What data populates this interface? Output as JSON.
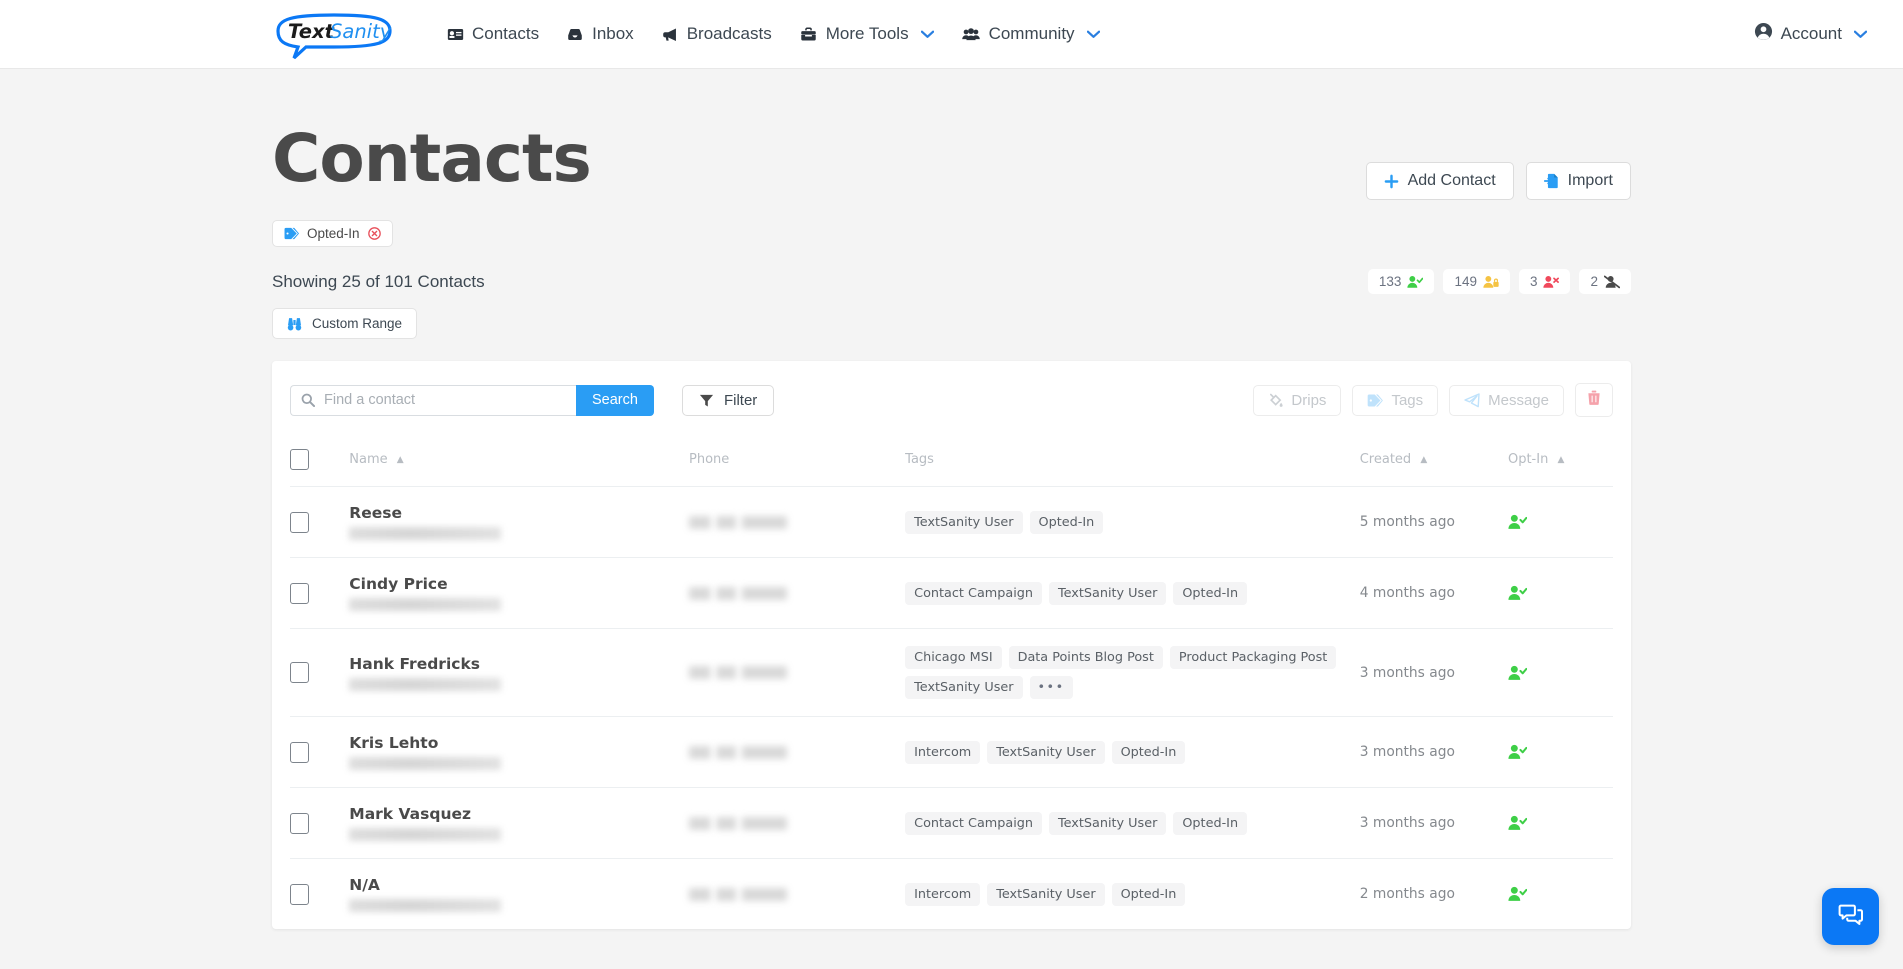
{
  "nav": {
    "logo_text_1": "Text",
    "logo_text_2": "Sanity",
    "items": [
      {
        "label": "Contacts",
        "icon": "id-card-icon",
        "caret": false
      },
      {
        "label": "Inbox",
        "icon": "inbox-icon",
        "caret": false
      },
      {
        "label": "Broadcasts",
        "icon": "bullhorn-icon",
        "caret": false
      },
      {
        "label": "More Tools",
        "icon": "toolbox-icon",
        "caret": true
      },
      {
        "label": "Community",
        "icon": "users-icon",
        "caret": true
      }
    ],
    "account_label": "Account"
  },
  "header": {
    "title": "Contacts",
    "add_contact_label": "Add Contact",
    "import_label": "Import",
    "filter_chip": {
      "label": "Opted-In",
      "remove_icon": "circle-x-icon"
    },
    "showing_text": "Showing 25 of 101 Contacts",
    "custom_range_label": "Custom Range",
    "stats": [
      {
        "count": "133",
        "icon": "user-check-icon",
        "color": "#3ecf47"
      },
      {
        "count": "149",
        "icon": "user-lock-icon",
        "color": "#f5c343"
      },
      {
        "count": "3",
        "icon": "user-times-icon",
        "color": "#f0485b"
      },
      {
        "count": "2",
        "icon": "user-slash-icon",
        "color": "#4a4a4a"
      }
    ]
  },
  "toolbar": {
    "search_value": "",
    "search_placeholder": "Find a contact",
    "search_button": "Search",
    "filter_button": "Filter",
    "bulk_actions": [
      {
        "label": "Drips",
        "icon": "fill-drip-icon",
        "disabled": true
      },
      {
        "label": "Tags",
        "icon": "tag-icon",
        "disabled": true
      },
      {
        "label": "Message",
        "icon": "paper-plane-icon",
        "disabled": true
      }
    ],
    "delete_icon": "trash-icon"
  },
  "table": {
    "columns": [
      {
        "label": "",
        "sort": ""
      },
      {
        "label": "Name",
        "sort": "asc"
      },
      {
        "label": "Phone",
        "sort": ""
      },
      {
        "label": "Tags",
        "sort": ""
      },
      {
        "label": "Created",
        "sort": "asc"
      },
      {
        "label": "Opt-In",
        "sort": "asc"
      }
    ],
    "rows": [
      {
        "name": "Reese",
        "tags": [
          "TextSanity User",
          "Opted-In"
        ],
        "overflow": false,
        "created": "5 months ago",
        "optin_icon": "user-check-icon"
      },
      {
        "name": "Cindy Price",
        "tags": [
          "Contact Campaign",
          "TextSanity User",
          "Opted-In"
        ],
        "overflow": false,
        "created": "4 months ago",
        "optin_icon": "user-check-icon"
      },
      {
        "name": "Hank Fredricks",
        "tags": [
          "Chicago MSI",
          "Data Points Blog Post",
          "Product Packaging Post",
          "TextSanity User"
        ],
        "overflow": true,
        "overflow_label": "•••",
        "created": "3 months ago",
        "optin_icon": "user-check-icon"
      },
      {
        "name": "Kris Lehto",
        "tags": [
          "Intercom",
          "TextSanity User",
          "Opted-In"
        ],
        "overflow": false,
        "created": "3 months ago",
        "optin_icon": "user-check-icon"
      },
      {
        "name": "Mark Vasquez",
        "tags": [
          "Contact Campaign",
          "TextSanity User",
          "Opted-In"
        ],
        "overflow": false,
        "created": "3 months ago",
        "optin_icon": "user-check-icon"
      },
      {
        "name": "N/A",
        "tags": [
          "Intercom",
          "TextSanity User",
          "Opted-In"
        ],
        "overflow": false,
        "created": "2 months ago",
        "optin_icon": "user-check-icon"
      }
    ]
  },
  "chat": {
    "icon": "chat-bubbles-icon"
  },
  "colors": {
    "accent": "#2a9df4",
    "chat": "#0b78f5",
    "green": "#3ecf47",
    "red": "#e8505b"
  }
}
